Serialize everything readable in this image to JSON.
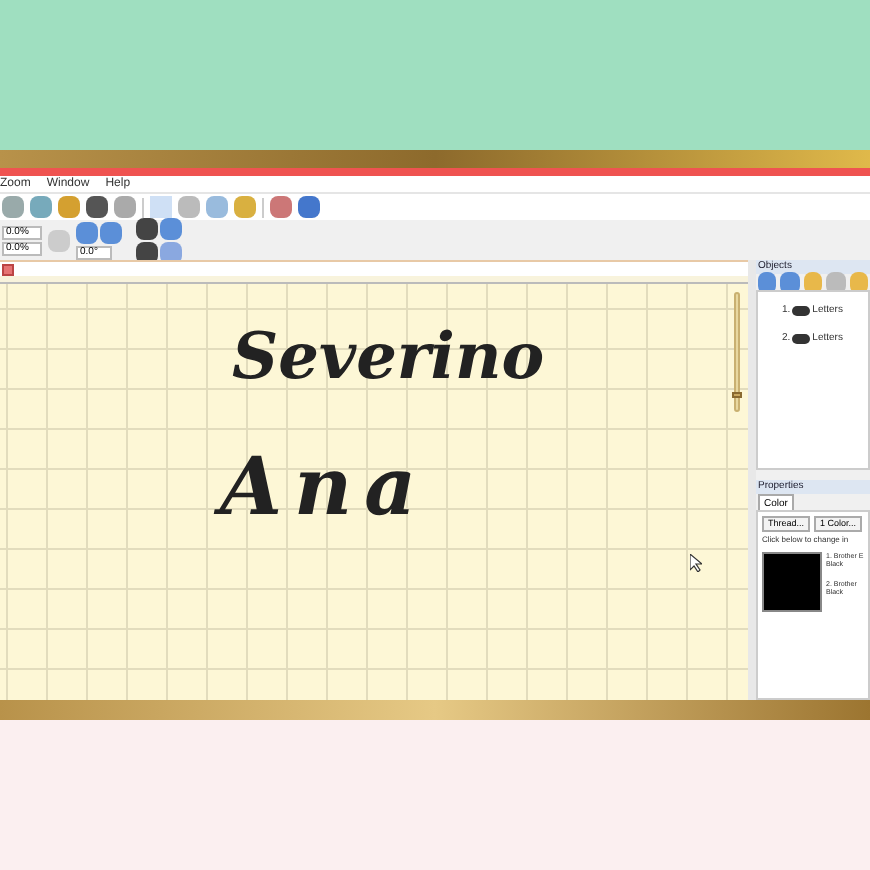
{
  "menu": [
    "Zoom",
    "Window",
    "Help"
  ],
  "toolbar_fields": [
    {
      "value": "0.0%"
    },
    {
      "value": "0.0%"
    },
    {
      "value": "0.0°"
    }
  ],
  "canvas": {
    "designs": [
      {
        "text": "Severino"
      },
      {
        "text": "Ana"
      }
    ],
    "zoom_slider": {
      "level": 0.1
    }
  },
  "objects_panel": {
    "title": "Objects",
    "items": [
      {
        "label": "1.",
        "name": "Letters"
      },
      {
        "label": "2.",
        "name": "Letters"
      }
    ]
  },
  "properties_panel": {
    "title": "Properties",
    "tabs": [
      {
        "label": "Color",
        "selected": true
      }
    ],
    "buttons": [
      "Thread...",
      "1 Color..."
    ],
    "hint": "Click below to change in",
    "threads": [
      {
        "name": "1. Brother E",
        "color_name": "Black"
      },
      {
        "name": "2. Brother",
        "color_name": "Black"
      }
    ]
  }
}
